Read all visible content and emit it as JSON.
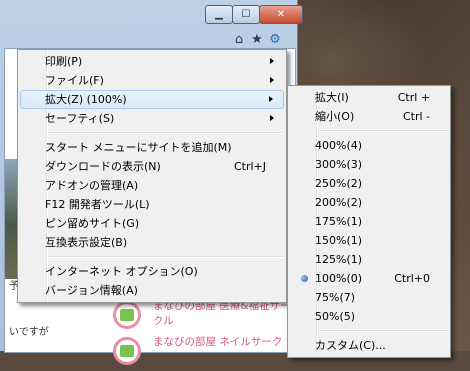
{
  "page": {
    "side_text_1": "予想も",
    "side_text_2": "いですが",
    "links": [
      "ル",
      "まなびの部屋 医療&福祉サークル",
      "まなびの部屋 ネイルサーク"
    ]
  },
  "toolbar": {
    "icons": [
      "home-icon",
      "favorites-star-icon",
      "gear-icon"
    ]
  },
  "tools_menu": {
    "items": [
      {
        "label": "印刷(P)",
        "submenu": true
      },
      {
        "label": "ファイル(F)",
        "submenu": true
      },
      {
        "label": "拡大(Z) (100%)",
        "submenu": true,
        "highlighted": true
      },
      {
        "label": "セーフティ(S)",
        "submenu": true
      },
      {
        "label": "スタート メニューにサイトを追加(M)"
      },
      {
        "label": "ダウンロードの表示(N)",
        "shortcut": "Ctrl+J"
      },
      {
        "label": "アドオンの管理(A)"
      },
      {
        "label": "F12 開発者ツール(L)"
      },
      {
        "label": "ピン留めサイト(G)"
      },
      {
        "label": "互換表示設定(B)"
      },
      {
        "label": "インターネット オプション(O)"
      },
      {
        "label": "バージョン情報(A)"
      }
    ]
  },
  "zoom_menu": {
    "items": [
      {
        "label": "拡大(I)",
        "shortcut": "Ctrl +"
      },
      {
        "label": "縮小(O)",
        "shortcut": "Ctrl -"
      },
      {
        "label": "400%(4)"
      },
      {
        "label": "300%(3)"
      },
      {
        "label": "250%(2)"
      },
      {
        "label": "200%(2)"
      },
      {
        "label": "175%(1)"
      },
      {
        "label": "150%(1)"
      },
      {
        "label": "125%(1)"
      },
      {
        "label": "100%(0)",
        "shortcut": "Ctrl+0",
        "selected": true
      },
      {
        "label": "75%(7)"
      },
      {
        "label": "50%(5)"
      },
      {
        "label": "カスタム(C)..."
      }
    ]
  }
}
